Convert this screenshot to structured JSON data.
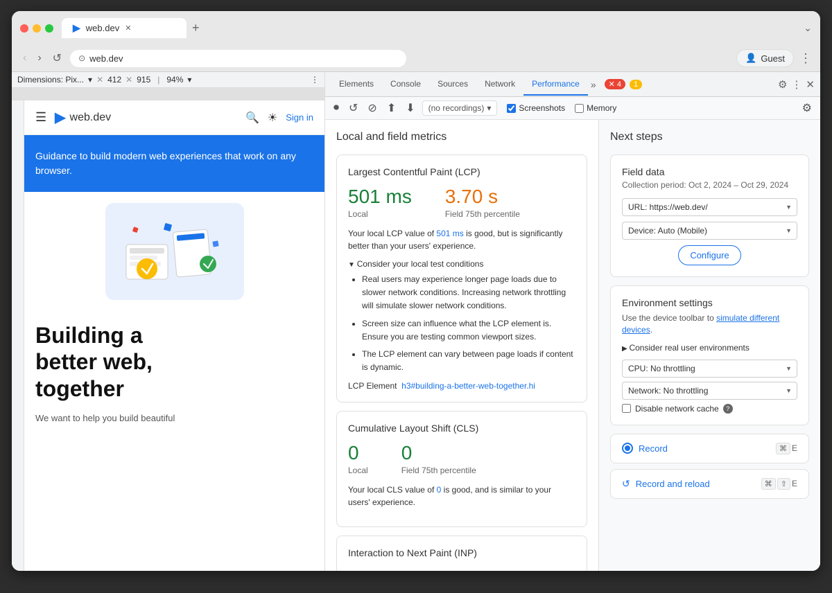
{
  "browser": {
    "tab_title": "web.dev",
    "tab_url": "web.dev",
    "address": "web.dev",
    "new_tab_tooltip": "New tab",
    "guest_label": "Guest"
  },
  "dimensions": {
    "label": "Dimensions: Pix...",
    "width": "412",
    "height": "915",
    "percent": "94%"
  },
  "devtools": {
    "tabs": [
      "Elements",
      "Console",
      "Sources",
      "Network",
      "Performance"
    ],
    "active_tab": "Performance",
    "badges": {
      "error_count": "4",
      "warning_count": "1"
    },
    "perf_toolbar": {
      "recordings_placeholder": "(no recordings)",
      "screenshots_label": "Screenshots",
      "memory_label": "Memory"
    }
  },
  "metrics": {
    "section_title": "Local and field metrics",
    "lcp": {
      "title": "Largest Contentful Paint (LCP)",
      "local_value": "501 ms",
      "field_value": "3.70 s",
      "local_label": "Local",
      "field_label": "Field 75th percentile",
      "description": "Your local LCP value of 501 ms is good, but is significantly better than your users' experience.",
      "highlight_text": "501 ms",
      "consider_title": "Consider your local test conditions",
      "bullets": [
        "Real users may experience longer page loads due to slower network conditions. Increasing network throttling will simulate slower network conditions.",
        "Screen size can influence what the LCP element is. Ensure you are testing common viewport sizes.",
        "The LCP element can vary between page loads if content is dynamic."
      ],
      "lcp_element_label": "LCP Element",
      "lcp_element_link": "h3#building-a-better-web-together.hi"
    },
    "cls": {
      "title": "Cumulative Layout Shift (CLS)",
      "local_value": "0",
      "field_value": "0",
      "local_label": "Local",
      "field_label": "Field 75th percentile",
      "description": "Your local CLS value of 0 is good, and is similar to your users' experience.",
      "highlight_text": "0"
    },
    "inp": {
      "title": "Interaction to Next Paint (INP)"
    }
  },
  "next_steps": {
    "title": "Next steps",
    "field_data": {
      "title": "Field data",
      "subtitle": "Collection period: Oct 2, 2024 – Oct 29, 2024",
      "url_label": "URL:",
      "url_value": "https://web.dev/",
      "device_label": "Device:",
      "device_value": "Auto (Mobile)",
      "configure_label": "Configure"
    },
    "env_settings": {
      "title": "Environment settings",
      "description": "Use the device toolbar to",
      "link_text": "simulate different devices",
      "description_end": ".",
      "consider_label": "Consider real user environments",
      "cpu_label": "CPU: No throttling",
      "network_label": "Network: No throttling",
      "disable_cache_label": "Disable network cache"
    },
    "record": {
      "label": "Record",
      "shortcut": "⌘ E"
    },
    "record_reload": {
      "label": "Record and reload",
      "shortcut": "⌘ ⇧ E"
    }
  },
  "website": {
    "logo_text": "web.dev",
    "sign_in": "Sign in",
    "hero_text": "Guidance to build modern web experiences that work on any browser.",
    "heading_line1": "Building a",
    "heading_line2": "better web,",
    "heading_line3": "together",
    "subtext": "We want to help you build beautiful"
  }
}
